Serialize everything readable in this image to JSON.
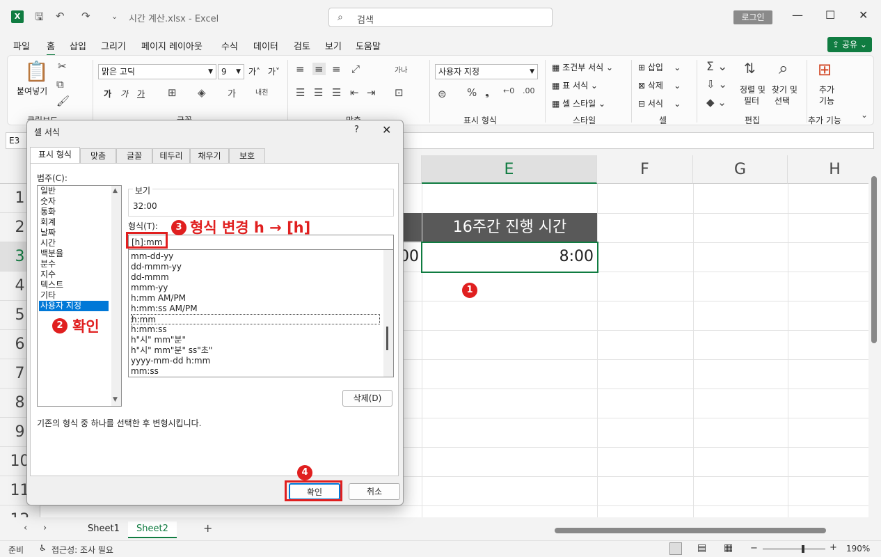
{
  "app": {
    "doc_title": "시간 계산.xlsx  -  Excel",
    "search_placeholder": "검색",
    "login": "로그인",
    "app_icon": "X"
  },
  "menu": {
    "tabs": [
      "파일",
      "홈",
      "삽입",
      "그리기",
      "페이지 레이아웃",
      "수식",
      "데이터",
      "검토",
      "보기",
      "도움말"
    ],
    "share": "공유"
  },
  "ribbon": {
    "paste": "붙여넣기",
    "clipboard": "클립보드",
    "font_name": "맑은 고딕",
    "font_size": "9",
    "font_group": "글꼴",
    "align_group": "맞춤",
    "number_format": "사용자 지정",
    "number_group": "표시 형식",
    "cond_format": "조건부 서식",
    "table_format": "표 서식",
    "cell_style": "셀 스타일",
    "style_group": "스타일",
    "insert": "삽입",
    "delete": "삭제",
    "format": "서식",
    "cell_group": "셀",
    "sort_filter_1": "정렬 및",
    "sort_filter_2": "필터",
    "find_select_1": "찾기 및",
    "find_select_2": "선택",
    "edit_group": "편집",
    "addins_1": "추가",
    "addins_2": "기능",
    "addins_group": "추가 기능",
    "bold": "가",
    "italic": "가",
    "underline": "가"
  },
  "formula": {
    "namebox": "E3"
  },
  "grid": {
    "columns": [
      "E",
      "F",
      "G",
      "H"
    ],
    "rows": [
      "1",
      "2",
      "3",
      "4",
      "5",
      "6",
      "7",
      "8",
      "9",
      "10",
      "11",
      "12"
    ],
    "header_e2": "16주간 진행 시간",
    "header_d2_partial": "",
    "value_e3": "8:00",
    "value_d3_partial": "00"
  },
  "sheets": {
    "tabs": [
      "Sheet1",
      "Sheet2"
    ],
    "active": "Sheet2",
    "add": "+"
  },
  "status": {
    "ready": "준비",
    "accessibility": "접근성: 조사 필요",
    "zoom": "190%"
  },
  "dialog": {
    "title": "셀 서식",
    "help": "?",
    "close": "✕",
    "tabs": [
      "표시 형식",
      "맞춤",
      "글꼴",
      "테두리",
      "채우기",
      "보호"
    ],
    "category_label": "범주(C):",
    "categories": [
      "일반",
      "숫자",
      "통화",
      "회계",
      "날짜",
      "시간",
      "백분율",
      "분수",
      "지수",
      "텍스트",
      "기타",
      "사용자 지정"
    ],
    "selected_category": "사용자 지정",
    "preview_label": "보기",
    "preview_value": "32:00",
    "type_label": "형식(T):",
    "type_value": "[h]:mm",
    "formats": [
      "mm-dd-yy",
      "dd-mmm-yy",
      "dd-mmm",
      "mmm-yy",
      "h:mm AM/PM",
      "h:mm:ss AM/PM",
      "h:mm",
      "h:mm:ss",
      "h\"시\" mm\"분\"",
      "h\"시\" mm\"분\" ss\"초\"",
      "yyyy-mm-dd h:mm",
      "mm:ss"
    ],
    "delete_btn": "삭제(D)",
    "description": "기존의 형식 중 하나를 선택한 후 변형시킵니다.",
    "ok": "확인",
    "cancel": "취소"
  },
  "annotations": {
    "badge1": "1",
    "badge2": "2",
    "badge3": "3",
    "badge4": "4",
    "text2": "확인",
    "text3": "형식 변경 h → [h]",
    "color": "#e01f1f"
  }
}
